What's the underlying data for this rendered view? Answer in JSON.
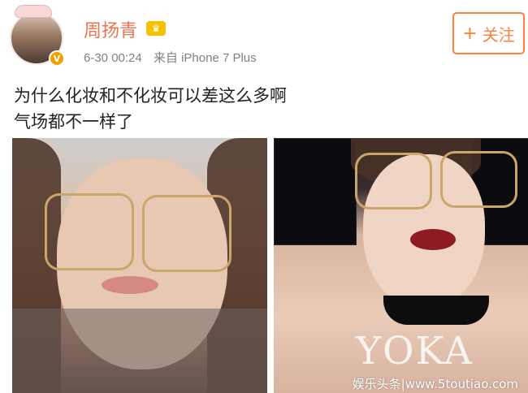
{
  "post": {
    "username": "周扬青",
    "vip_icon": "crown-vip-icon",
    "timestamp": "6-30 00:24",
    "source": "来自 iPhone 7 Plus",
    "follow_label": "关注",
    "follow_plus": "+",
    "text_line1": "为什么化妆和不化妆可以差这么多啊",
    "text_line2": "气场都不一样了",
    "verified_badge": "V"
  },
  "watermark": {
    "yoka": "YOKA",
    "site": "娱乐头条|www.5toutiao.com"
  },
  "colors": {
    "username": "#eb7350",
    "follow": "#ff8140",
    "verified": "#f2a200"
  }
}
